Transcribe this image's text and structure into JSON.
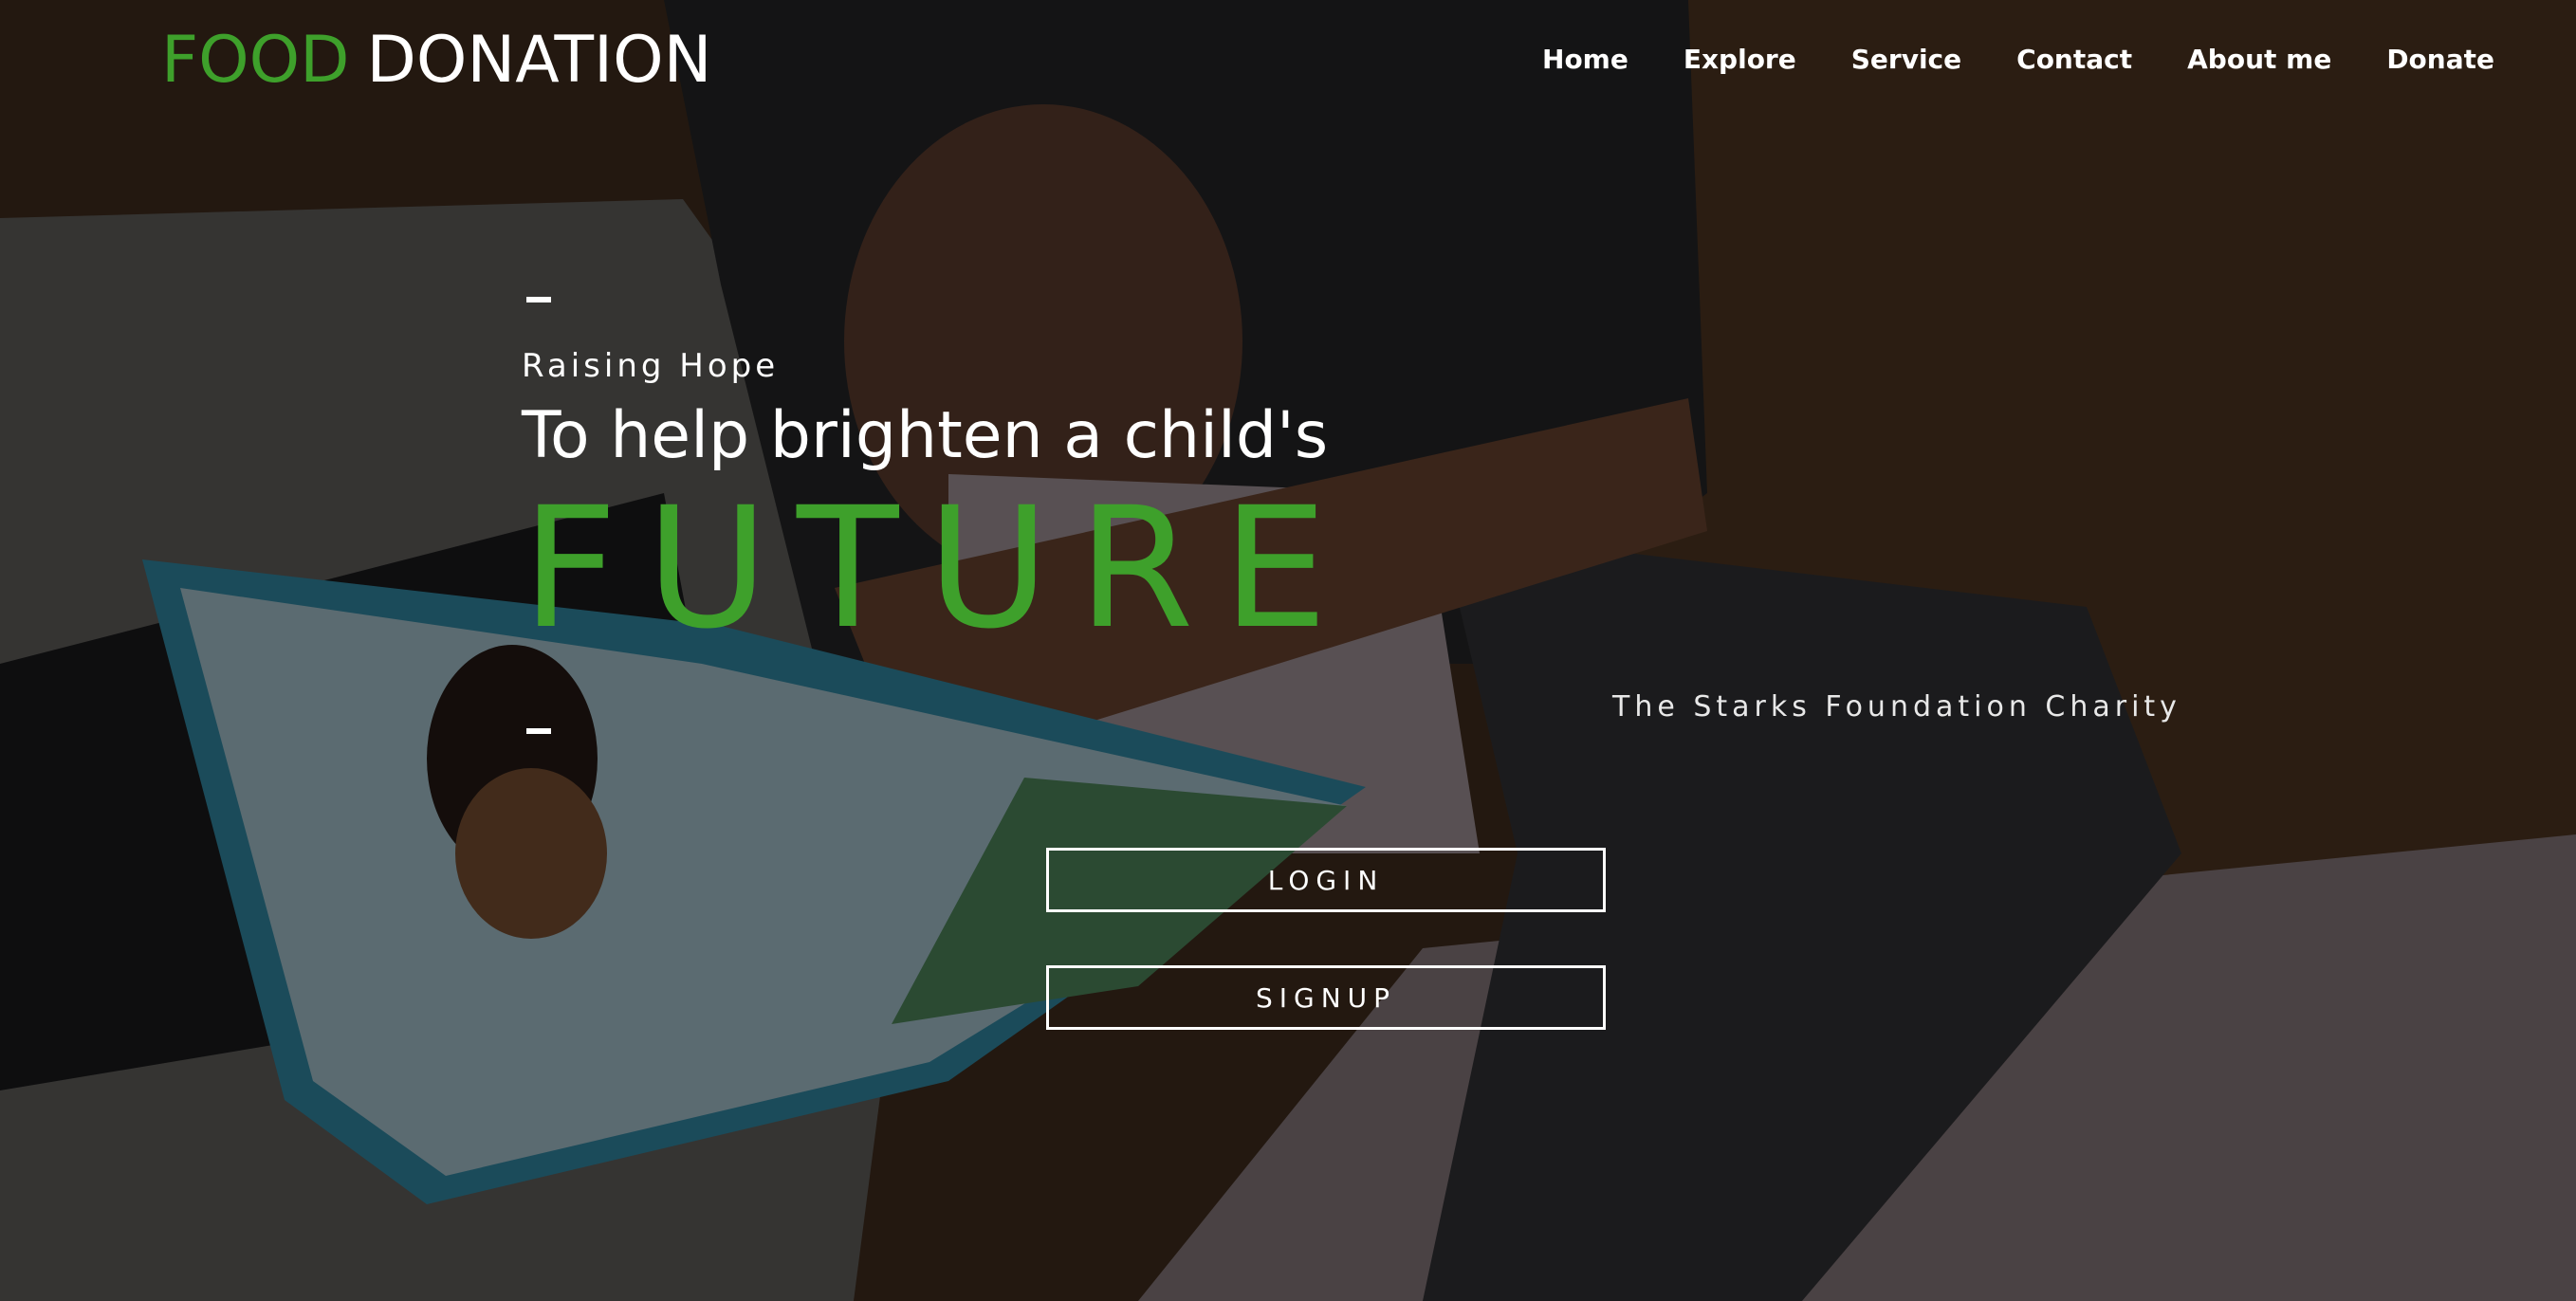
{
  "brand": {
    "word1": "FOOD",
    "word2": "DONATION",
    "accent_color": "#3ea02b"
  },
  "nav": {
    "items": [
      "Home",
      "Explore",
      "Service",
      "Contact",
      "About me",
      "Donate"
    ]
  },
  "hero": {
    "subtitle": "Raising Hope",
    "headline": "To help brighten a child's",
    "emphasis": "FUTURE",
    "tagline": "The Starks Foundation Charity",
    "login_label": "LOGIN",
    "signup_label": "SIGNUP"
  }
}
